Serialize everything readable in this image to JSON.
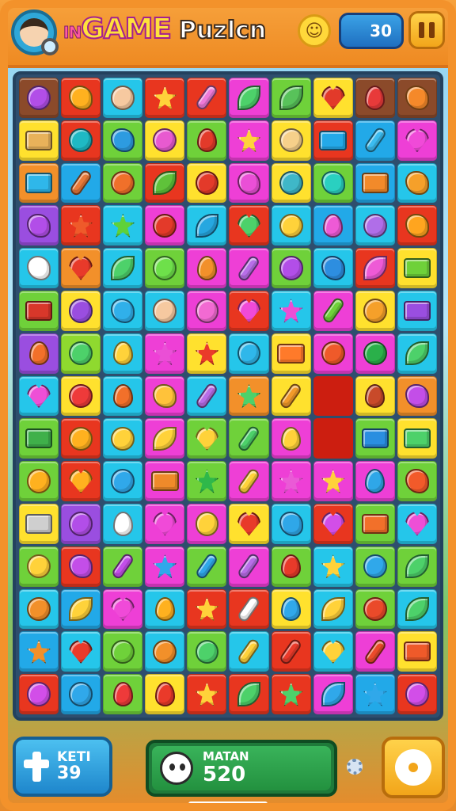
{
  "header": {
    "logo_prefix": "IN",
    "logo_game": "GAME",
    "logo_title": "Puzlcn",
    "score_value": "30"
  },
  "footer": {
    "hint_label_1": "KETI",
    "hint_label_2": "39",
    "match_label": "MATAN",
    "match_value": "520"
  },
  "colors": {
    "brown": "#8b4a2a",
    "red": "#e8361f",
    "cyan": "#25c6ea",
    "orange": "#f2902a",
    "yellow": "#ffe12e",
    "magenta": "#ee3fd6",
    "green": "#6fd13a",
    "blue": "#22a9e8",
    "purple": "#9a4ee0",
    "pink": "#f36ad2",
    "lime": "#8fd92f",
    "dark": "#3a2b3a",
    "empty": "#cc1e10"
  },
  "board": {
    "rows": 15,
    "cols": 10,
    "tiles": [
      [
        "brown:circle:#b24ee8",
        "red:blob:#ffb11f",
        "cyan:face:#f6c9a0",
        "red:star:#ffd23a",
        "red:pill:#ee7ad8",
        "magenta:leaf:#4dd16a",
        "green:leaf:#58c25a",
        "yellow:heart:#e23a2a",
        "brown:drop:#e83a3a",
        "brown:blob:#f5892a"
      ],
      [
        "yellow:box:#e8b25a",
        "red:circle:#1fb9c4",
        "green:blob:#2d9be0",
        "yellow:face:#e85ad0",
        "green:drop:#e33a2a",
        "magenta:star:#ffd23a",
        "yellow:face:#f6d08a",
        "red:box:#24a9e8",
        "blue:pill:#3bbcf0",
        "magenta:heart:#f04ad8"
      ],
      [
        "orange:box:#2fb7ea",
        "blue:pill:#e87a3a",
        "green:face:#f0702a",
        "red:leaf:#5fc23a",
        "yellow:face:#e33a2a",
        "magenta:blob:#ea4fd6",
        "yellow:circle:#3fb7c8",
        "green:blob:#2ad0c0",
        "blue:box:#f28a2a",
        "cyan:blob:#f5a02a"
      ],
      [
        "purple:blob:#b24ee8",
        "red:star:#ef5a2a",
        "cyan:star:#5fd13a",
        "magenta:face:#e33a2a",
        "cyan:leaf:#26a7e0",
        "red:heart:#4dd16a",
        "cyan:face:#ffd23a",
        "blue:drop:#ee5ad6",
        "cyan:face:#b06ee8",
        "red:blob:#ffa51f"
      ],
      [
        "cyan:blob:#ffffff",
        "orange:heart:#e83a2a",
        "cyan:leaf:#4dd16a",
        "green:circle:#6ee04a",
        "magenta:drop:#f2902a",
        "magenta:pill:#b86ee8",
        "green:circle:#b24ee8",
        "cyan:blob:#2d8ee0",
        "red:leaf:#ee5ad6",
        "yellow:box:#6fd13a"
      ],
      [
        "green:box:#d8372a",
        "yellow:circle:#9a4ee0",
        "cyan:blob:#30b0ea",
        "cyan:face:#f6c9a0",
        "magenta:face:#f26ad2",
        "red:heart:#f04ad8",
        "cyan:star:#ea4fd6",
        "magenta:pill:#6fd13a",
        "yellow:circle:#f5a02a",
        "cyan:box:#9a4ee0"
      ],
      [
        "purple:drop:#f2702a",
        "lime:face:#4dd16a",
        "cyan:drop:#ffd23a",
        "magenta:star:#ea4fd6",
        "yellow:star:#ea3a2a",
        "cyan:face:#2fb7ea",
        "yellow:box:#ff7a2a",
        "magenta:circle:#ef5a2a",
        "magenta:face:#2ab04a",
        "cyan:leaf:#4dd16a"
      ],
      [
        "cyan:heart:#ee4fd6",
        "yellow:face:#ee3a3a",
        "cyan:drop:#f2702a",
        "magenta:blob:#ffc23a",
        "cyan:pill:#b86ee8",
        "orange:star:#4dd16a",
        "yellow:pill:#f29a2a",
        "empty:none:none",
        "yellow:drop:#c84a2a",
        "orange:blob:#c34ee8"
      ],
      [
        "green:box:#3fb04a",
        "red:circle:#ffb11f",
        "cyan:circle:#ffd23a",
        "magenta:leaf:#ffd23a",
        "green:heart:#ffd23a",
        "green:pill:#4dd16a",
        "magenta:drop:#ffd23a",
        "empty:none:none",
        "green:box:#2a8ee0",
        "yellow:box:#4dd16a"
      ],
      [
        "green:circle:#ffb11f",
        "red:heart:#ffb11f",
        "cyan:face:#30a8ea",
        "magenta:box:#ef8a2a",
        "green:star:#2fb84a",
        "magenta:pill:#ffd23a",
        "magenta:star:#ea5ad6",
        "magenta:star:#ffd23a",
        "magenta:drop:#2fa7e8",
        "green:blob:#f25a2a"
      ],
      [
        "yellow:box:#cfcfcf",
        "purple:circle:#b24ee8",
        "cyan:drop:#ffffff",
        "magenta:heart:#f04ad8",
        "magenta:face:#ffd23a",
        "yellow:heart:#e83a2a",
        "cyan:blob:#2fa7e8",
        "red:heart:#d24ee8",
        "green:box:#f2702a",
        "cyan:heart:#ee4fd6"
      ],
      [
        "green:face:#ffd23a",
        "red:blob:#c34ee8",
        "green:pill:#c34ee8",
        "magenta:star:#30a8ea",
        "green:pill:#30a8ea",
        "magenta:pill:#b86ee8",
        "green:drop:#e83a2a",
        "cyan:star:#ffd23a",
        "green:face:#30a8ea",
        "green:leaf:#4dd16a"
      ],
      [
        "cyan:circle:#f2902a",
        "blue:leaf:#ffd23a",
        "magenta:heart:#f04ad8",
        "cyan:drop:#ffb11f",
        "red:star:#ffd23a",
        "red:pill:#ffffff",
        "yellow:drop:#30a8ea",
        "cyan:leaf:#ffd23a",
        "green:circle:#ea4a2a",
        "cyan:leaf:#4dd16a"
      ],
      [
        "blue:star:#f2902a",
        "cyan:heart:#ea3a2a",
        "green:face:#6fd13a",
        "cyan:face:#f2902a",
        "green:circle:#4dd16a",
        "cyan:pill:#ffd23a",
        "red:pill:#ea3a2a",
        "cyan:heart:#ffd23a",
        "magenta:pill:#ea4a2a",
        "yellow:box:#ef5a2a"
      ],
      [
        "red:circle:#d24ee8",
        "blue:circle:#30a8ea",
        "green:drop:#ee3a3a",
        "yellow:drop:#ea3a2a",
        "red:star:#ffd23a",
        "red:leaf:#4dd16a",
        "red:star:#4dd16a",
        "magenta:leaf:#30a8ea",
        "blue:star:#30a8ea",
        "red:circle:#d24ee8"
      ]
    ]
  }
}
